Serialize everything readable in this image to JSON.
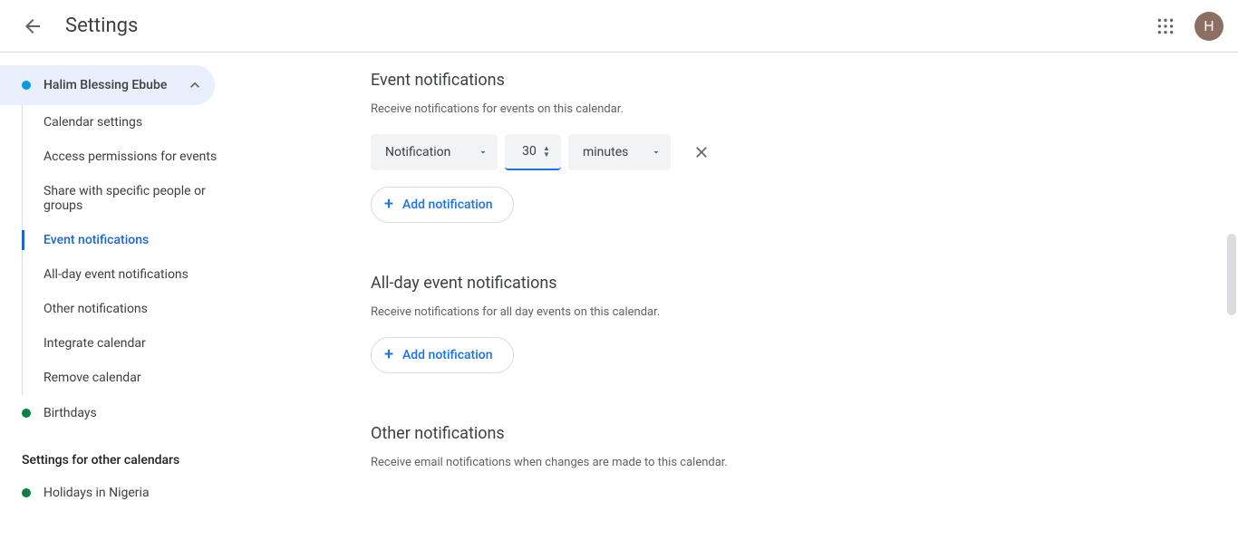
{
  "header": {
    "title": "Settings",
    "avatar_letter": "H"
  },
  "sidebar": {
    "calendar": {
      "name": "Halim Blessing Ebube",
      "color": "#039be5"
    },
    "items": [
      {
        "label": "Calendar settings"
      },
      {
        "label": "Access permissions for events"
      },
      {
        "label": "Share with specific people or groups"
      },
      {
        "label": "Event notifications"
      },
      {
        "label": "All-day event notifications"
      },
      {
        "label": "Other notifications"
      },
      {
        "label": "Integrate calendar"
      },
      {
        "label": "Remove calendar"
      }
    ],
    "birthdays": {
      "label": "Birthdays",
      "color": "#0b8043"
    },
    "other_title": "Settings for other calendars",
    "holidays": {
      "label": "Holidays in Nigeria",
      "color": "#0b8043"
    }
  },
  "sections": {
    "event_notifs": {
      "title": "Event notifications",
      "desc": "Receive notifications for events on this calendar.",
      "row": {
        "type_label": "Notification",
        "value": "30",
        "unit_label": "minutes"
      },
      "add_label": "Add notification"
    },
    "allday": {
      "title": "All-day event notifications",
      "desc": "Receive notifications for all day events on this calendar.",
      "add_label": "Add notification"
    },
    "other": {
      "title": "Other notifications",
      "desc": "Receive email notifications when changes are made to this calendar."
    }
  }
}
